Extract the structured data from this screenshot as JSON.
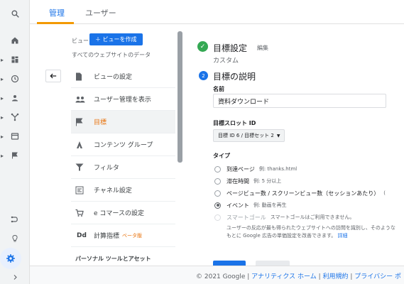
{
  "tabs": {
    "admin": "管理",
    "user": "ユーザー"
  },
  "rail": {
    "icons": [
      "search-icon",
      "home-icon",
      "dashboard-icon",
      "clock-icon",
      "person-icon",
      "acquisition-icon",
      "behavior-icon",
      "flag-icon",
      "attribution-icon",
      "lightbulb-icon",
      "gear-icon",
      "chevron-right-icon"
    ]
  },
  "view": {
    "label": "ビュー",
    "create_button": "＋ ビューを作成",
    "subtitle": "すべてのウェブサイトのデータ"
  },
  "menu": {
    "items": [
      {
        "label": "ビューの設定",
        "icon": "document-icon"
      },
      {
        "label": "ユーザー管理を表示",
        "icon": "people-icon"
      },
      {
        "label": "目標",
        "icon": "flag-icon",
        "active": true
      },
      {
        "label": "コンテンツ グループ",
        "icon": "content-group-icon"
      },
      {
        "label": "フィルタ",
        "icon": "filter-icon"
      },
      {
        "label": "チャネル設定",
        "icon": "channel-icon"
      },
      {
        "label": "e コマースの設定",
        "icon": "cart-icon"
      },
      {
        "label": "計算指標",
        "icon": "dd-icon",
        "tag": "ベータ版"
      }
    ],
    "section": "パーソナル ツールとアセット"
  },
  "goal": {
    "step1_title": "目標設定",
    "step1_edit": "編集",
    "step1_value": "カスタム",
    "step2_number": "2",
    "step2_title": "目標の説明",
    "name_label": "名前",
    "name_value": "資料ダウンロード",
    "slot_label": "目標スロット ID",
    "slot_value": "目標 ID 6 / 目標セット 2",
    "type_label": "タイプ",
    "types": [
      {
        "label": "到達ページ",
        "example": "例: thanks.html"
      },
      {
        "label": "滞在時間",
        "example": "例: 5 分以上"
      },
      {
        "label": "ページビュー数 / スクリーンビュー数（セッションあたり）",
        "example": "("
      },
      {
        "label": "イベント",
        "example": "例: 動画を再生",
        "checked": true
      },
      {
        "label": "スマートゴール",
        "example": "スマートゴールはご利用できません。",
        "disabled": true
      }
    ],
    "smart_help_line1": "ユーザーの反応が最も得られたウェブサイトへの訪問を識別し、そのような",
    "smart_help_line2": "もとに Google 広告の単価設定を改善できます。",
    "smart_help_link": "詳細"
  },
  "footer": {
    "copyright": "© 2021 Google",
    "links": [
      "アナリティクス ホーム",
      "利用規約",
      "プライバシー ポ"
    ]
  },
  "colors": {
    "accent": "#1a73e8",
    "tab_underline": "#f29900",
    "active_item": "#e8710a",
    "success": "#34a853"
  }
}
